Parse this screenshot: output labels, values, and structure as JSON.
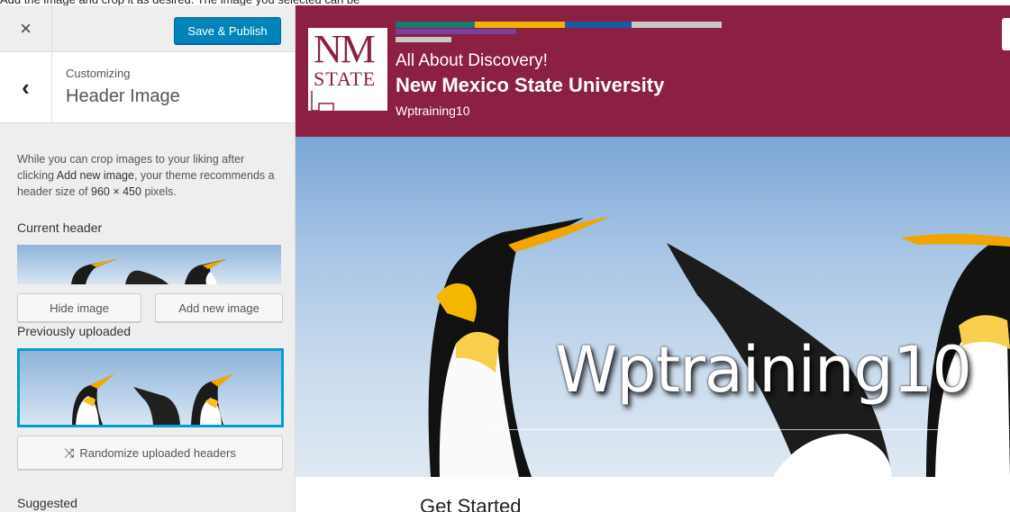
{
  "caption": "Add the image and crop it as desired. The image you selected can be",
  "topbar": {
    "close_symbol": "×",
    "save_label": "Save & Publish"
  },
  "section": {
    "breadcrumb": "Customizing",
    "title": "Header Image",
    "back_symbol": "‹"
  },
  "description": {
    "part1": "While you can crop images to your liking after clicking ",
    "bold1": "Add new image",
    "part2": ", your theme recommends a header size of ",
    "bold2": "960 × 450",
    "part3": " pixels."
  },
  "current_header": {
    "label": "Current header",
    "hide_label": "Hide image",
    "add_label": "Add new image"
  },
  "previously_uploaded": {
    "label": "Previously uploaded",
    "randomize_label": "Randomize uploaded headers",
    "randomize_icon": "shuffle-icon"
  },
  "suggested": {
    "label": "Suggested"
  },
  "site": {
    "tagline": "All About Discovery!",
    "university": "New Mexico State University",
    "site_name": "Wptraining10",
    "logo_top": "NM",
    "logo_bottom": "STATE",
    "brand_color": "#8b2042"
  },
  "hero": {
    "title": "Wptraining10"
  },
  "content": {
    "heading": "Get Started"
  },
  "colors": {
    "accent": "#0085ba",
    "selected_border": "#00a0d2"
  }
}
